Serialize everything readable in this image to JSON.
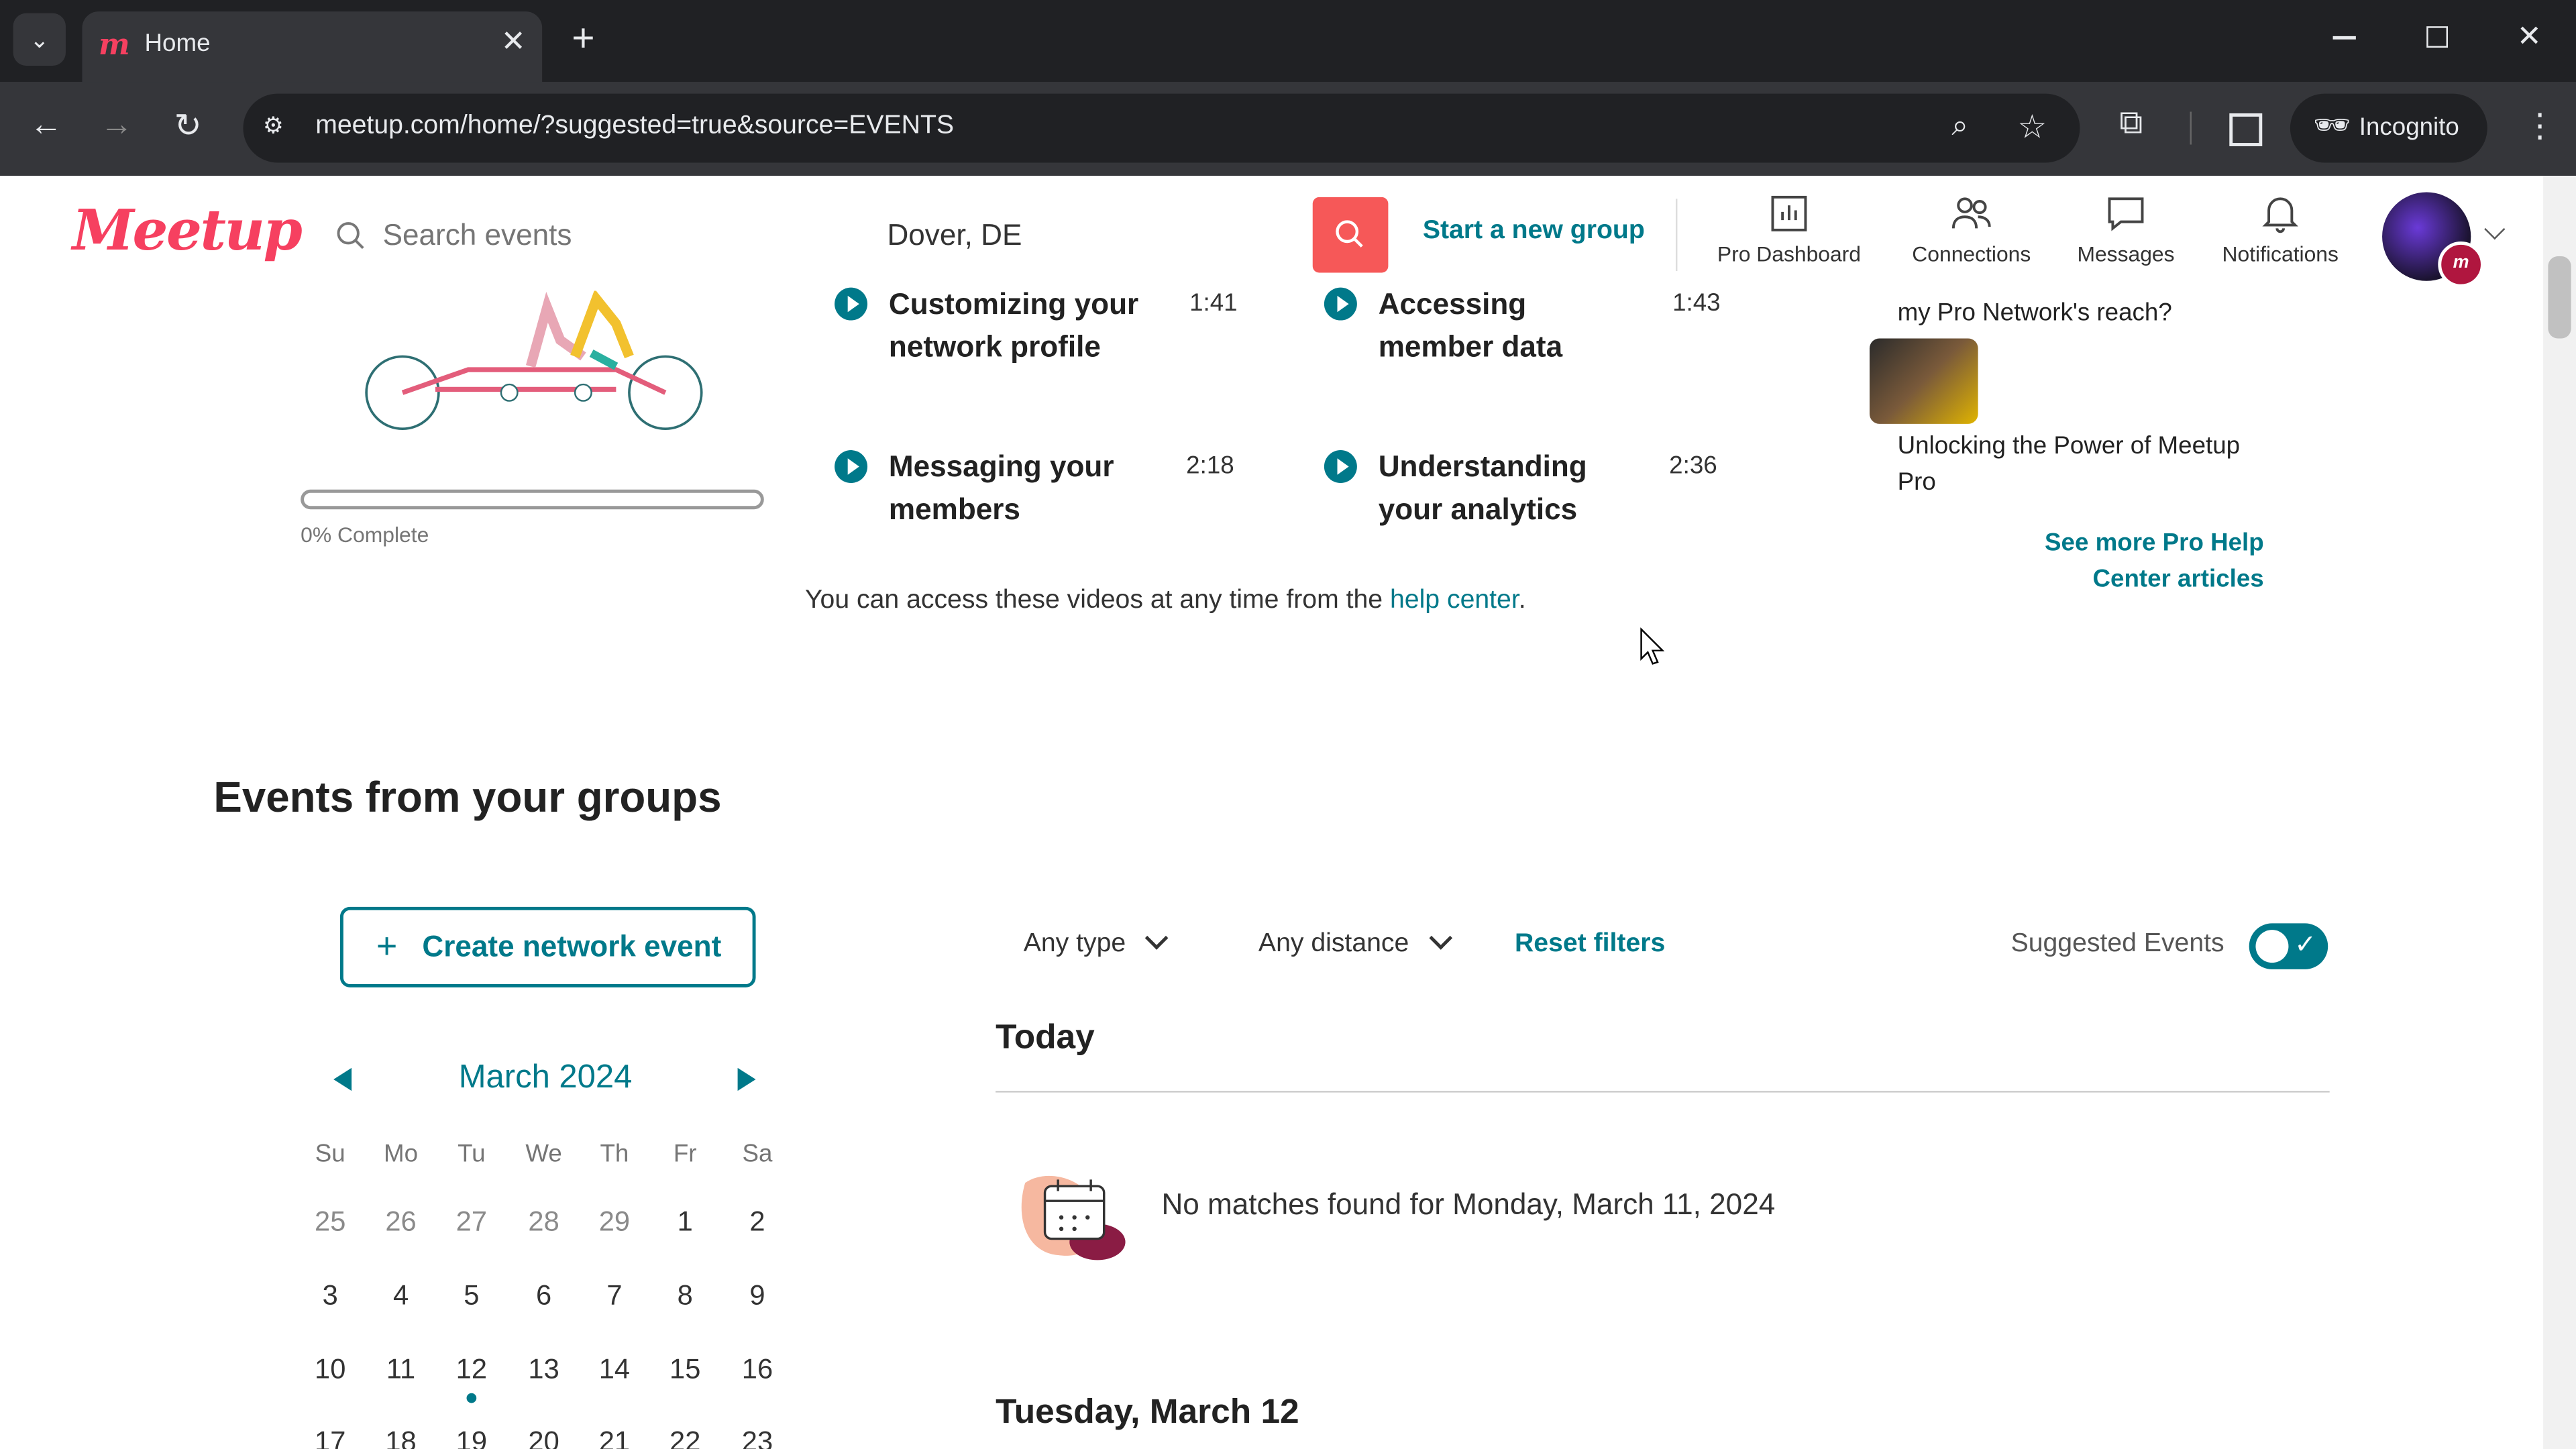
{
  "browser": {
    "tab_title": "Home",
    "new_tab": "+",
    "close": "✕",
    "url": "meetup.com/home/?suggested=true&source=EVENTS",
    "incognito_label": "Incognito"
  },
  "header": {
    "logo": "Meetup",
    "search_placeholder": "Search events",
    "location": "Dover, DE",
    "start_group": "Start a new group",
    "nav": {
      "pro_dashboard": "Pro Dashboard",
      "connections": "Connections",
      "messages": "Messages",
      "notifications": "Notifications"
    },
    "avatar_badge": "m"
  },
  "videos": [
    {
      "title_l1": "Customizing your",
      "title_l2": "network profile",
      "duration": "1:41"
    },
    {
      "title_l1": "Accessing",
      "title_l2": "member data",
      "duration": "1:43"
    },
    {
      "title_l1": "Messaging your",
      "title_l2": "members",
      "duration": "2:18"
    },
    {
      "title_l1": "Understanding",
      "title_l2": "your analytics",
      "duration": "2:36"
    }
  ],
  "progress": {
    "percent": 0,
    "label": "0% Complete"
  },
  "access_text": "You can access these videos at any time from the",
  "help_center": "help center",
  "access_end": ".",
  "pro_help": {
    "question": "my Pro Network's reach?",
    "article_title": "Unlocking the Power of Meetup Pro",
    "see_more_l1": "See more Pro Help",
    "see_more_l2": "Center articles"
  },
  "events": {
    "heading": "Events from your groups",
    "create_button": "Create network event",
    "month": "March 2024",
    "weekdays": [
      "Su",
      "Mo",
      "Tu",
      "We",
      "Th",
      "Fr",
      "Sa"
    ],
    "weeks": [
      [
        "25",
        "26",
        "27",
        "28",
        "29",
        "1",
        "2"
      ],
      [
        "3",
        "4",
        "5",
        "6",
        "7",
        "8",
        "9"
      ],
      [
        "10",
        "11",
        "12",
        "13",
        "14",
        "15",
        "16"
      ],
      [
        "17",
        "18",
        "19",
        "20",
        "21",
        "22",
        "23"
      ]
    ],
    "filter_type": "Any type",
    "filter_distance": "Any distance",
    "reset": "Reset filters",
    "suggested_label": "Suggested Events",
    "suggested_on": true,
    "today_heading": "Today",
    "no_matches": "No matches found for Monday, March 11, 2024",
    "next_heading": "Tuesday, March 12"
  },
  "colors": {
    "brand": "#f64060",
    "accent": "#00798a",
    "search_button": "#f65858"
  }
}
